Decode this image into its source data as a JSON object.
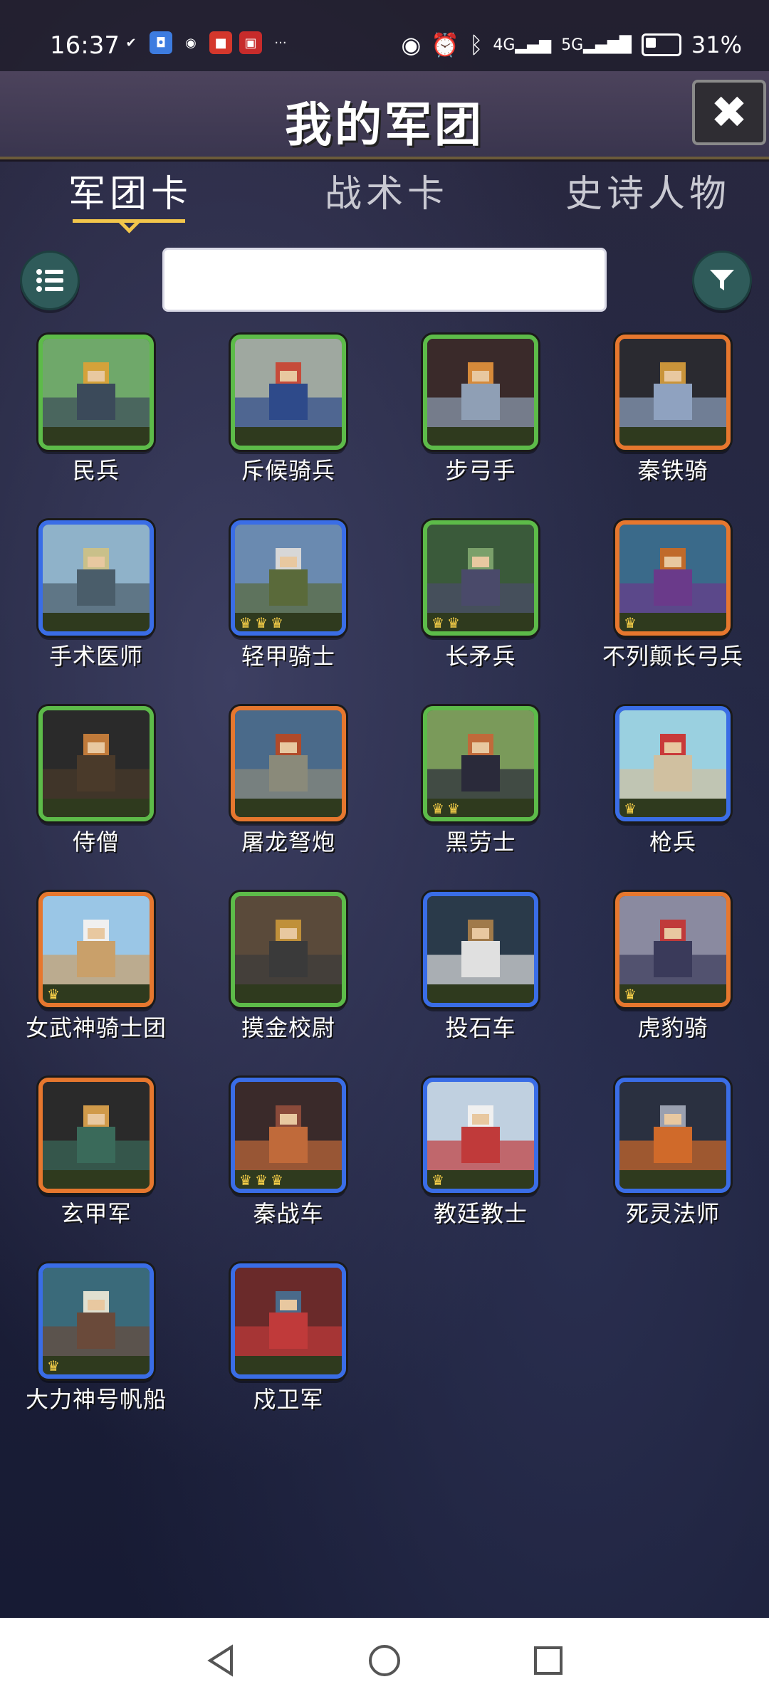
{
  "status_bar": {
    "time": "16:37",
    "left_icons": [
      "check-icon",
      "shield-app-icon",
      "wechat-icon",
      "ting-app-icon",
      "news-app-icon",
      "more-dots-icon"
    ],
    "right_icons": [
      "eye-icon",
      "alarm-icon",
      "bluetooth-icon",
      "signal-4g-icon",
      "signal-5g-icon",
      "battery-icon"
    ],
    "battery": "31%"
  },
  "header": {
    "title": "我的军团",
    "close_icon": "close-x-icon"
  },
  "tabs": [
    {
      "label": "军团卡",
      "active": true
    },
    {
      "label": "战术卡",
      "active": false
    },
    {
      "label": "史诗人物",
      "active": false
    }
  ],
  "controls": {
    "list_icon": "list-icon",
    "search": {
      "value": "",
      "placeholder": ""
    },
    "filter_icon": "filter-icon"
  },
  "cards": [
    {
      "name": "民兵",
      "rarity": "green",
      "crowns": 0
    },
    {
      "name": "斥候骑兵",
      "rarity": "green",
      "crowns": 0
    },
    {
      "name": "步弓手",
      "rarity": "green",
      "crowns": 0
    },
    {
      "name": "秦铁骑",
      "rarity": "orange",
      "crowns": 0
    },
    {
      "name": "手术医师",
      "rarity": "blue",
      "crowns": 0
    },
    {
      "name": "轻甲骑士",
      "rarity": "blue",
      "crowns": 3
    },
    {
      "name": "长矛兵",
      "rarity": "green",
      "crowns": 2
    },
    {
      "name": "不列颠长弓兵",
      "rarity": "orange",
      "crowns": 1
    },
    {
      "name": "侍僧",
      "rarity": "green",
      "crowns": 0
    },
    {
      "name": "屠龙弩炮",
      "rarity": "orange",
      "crowns": 0
    },
    {
      "name": "黑劳士",
      "rarity": "green",
      "crowns": 2
    },
    {
      "name": "枪兵",
      "rarity": "blue",
      "crowns": 1
    },
    {
      "name": "女武神骑士团",
      "rarity": "orange",
      "crowns": 1
    },
    {
      "name": "摸金校尉",
      "rarity": "green",
      "crowns": 0
    },
    {
      "name": "投石车",
      "rarity": "blue",
      "crowns": 0
    },
    {
      "name": "虎豹骑",
      "rarity": "orange",
      "crowns": 1
    },
    {
      "name": "玄甲军",
      "rarity": "orange",
      "crowns": 0
    },
    {
      "name": "秦战车",
      "rarity": "blue",
      "crowns": 3
    },
    {
      "name": "教廷教士",
      "rarity": "blue",
      "crowns": 1
    },
    {
      "name": "死灵法师",
      "rarity": "blue",
      "crowns": 0
    },
    {
      "name": "大力神号帆船",
      "rarity": "blue",
      "crowns": 1
    },
    {
      "name": "戍卫军",
      "rarity": "blue",
      "crowns": 0
    }
  ],
  "colors": {
    "green_border": "#5dbb49",
    "orange_border": "#e6772e",
    "blue_border": "#3a6de6",
    "accent_gold": "#f3c64b",
    "teal_button": "#2f5b5a"
  },
  "nav": {
    "back_icon": "back-triangle-icon",
    "home_icon": "home-circle-icon",
    "recents_icon": "recents-square-icon"
  }
}
